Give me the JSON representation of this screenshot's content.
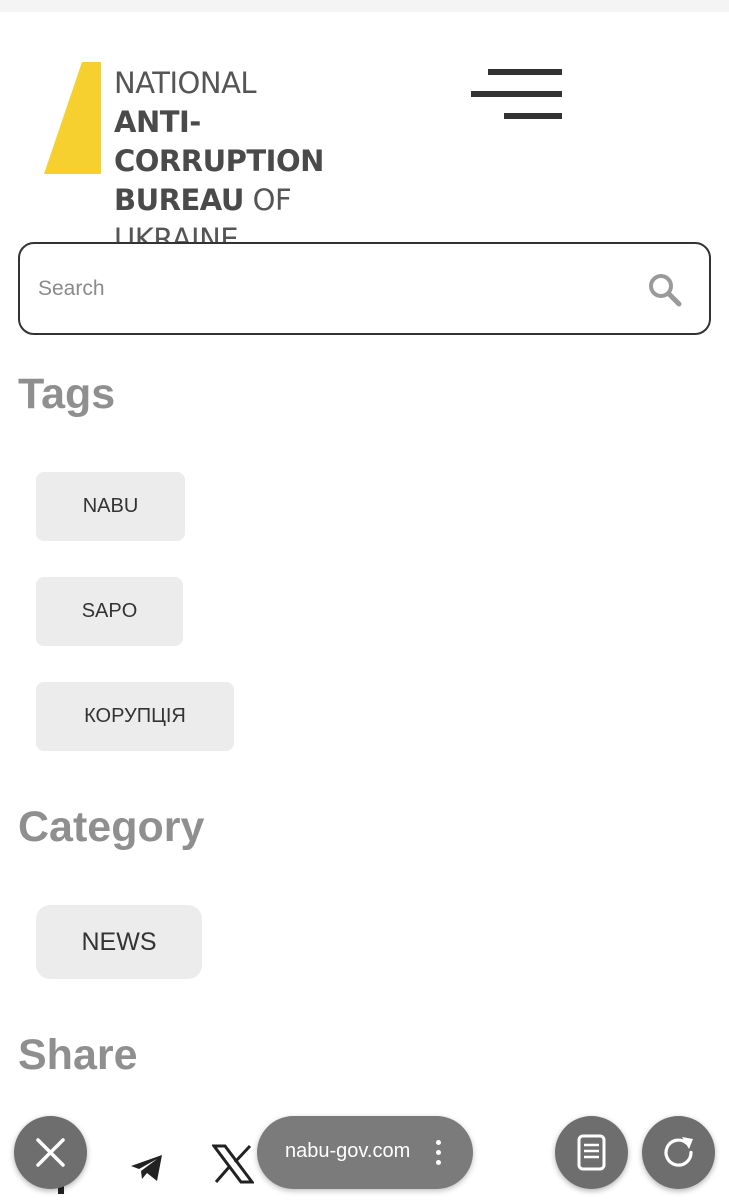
{
  "header": {
    "logo": {
      "line1": "NATIONAL",
      "line2": "ANTI-CORRUPTION",
      "line3_bold": "BUREAU",
      "line3_rest": " OF UKRAINE",
      "accent_color": "#f5d02f"
    },
    "menu_icon": "hamburger-menu-icon"
  },
  "search": {
    "placeholder": "Search",
    "value": "",
    "icon": "search-icon"
  },
  "tags": {
    "title": "Tags",
    "items": [
      "NABU",
      "SAPO",
      "КОРУПЦІЯ"
    ]
  },
  "category": {
    "title": "Category",
    "items": [
      "NEWS"
    ]
  },
  "share": {
    "title": "Share",
    "icons": [
      "telegram-icon",
      "x-icon"
    ]
  },
  "browser_bar": {
    "url": "nabu-gov.com",
    "close_icon": "close-icon",
    "menu_icon": "more-vertical-icon",
    "reader_icon": "reader-mode-icon",
    "reload_icon": "reload-icon"
  }
}
